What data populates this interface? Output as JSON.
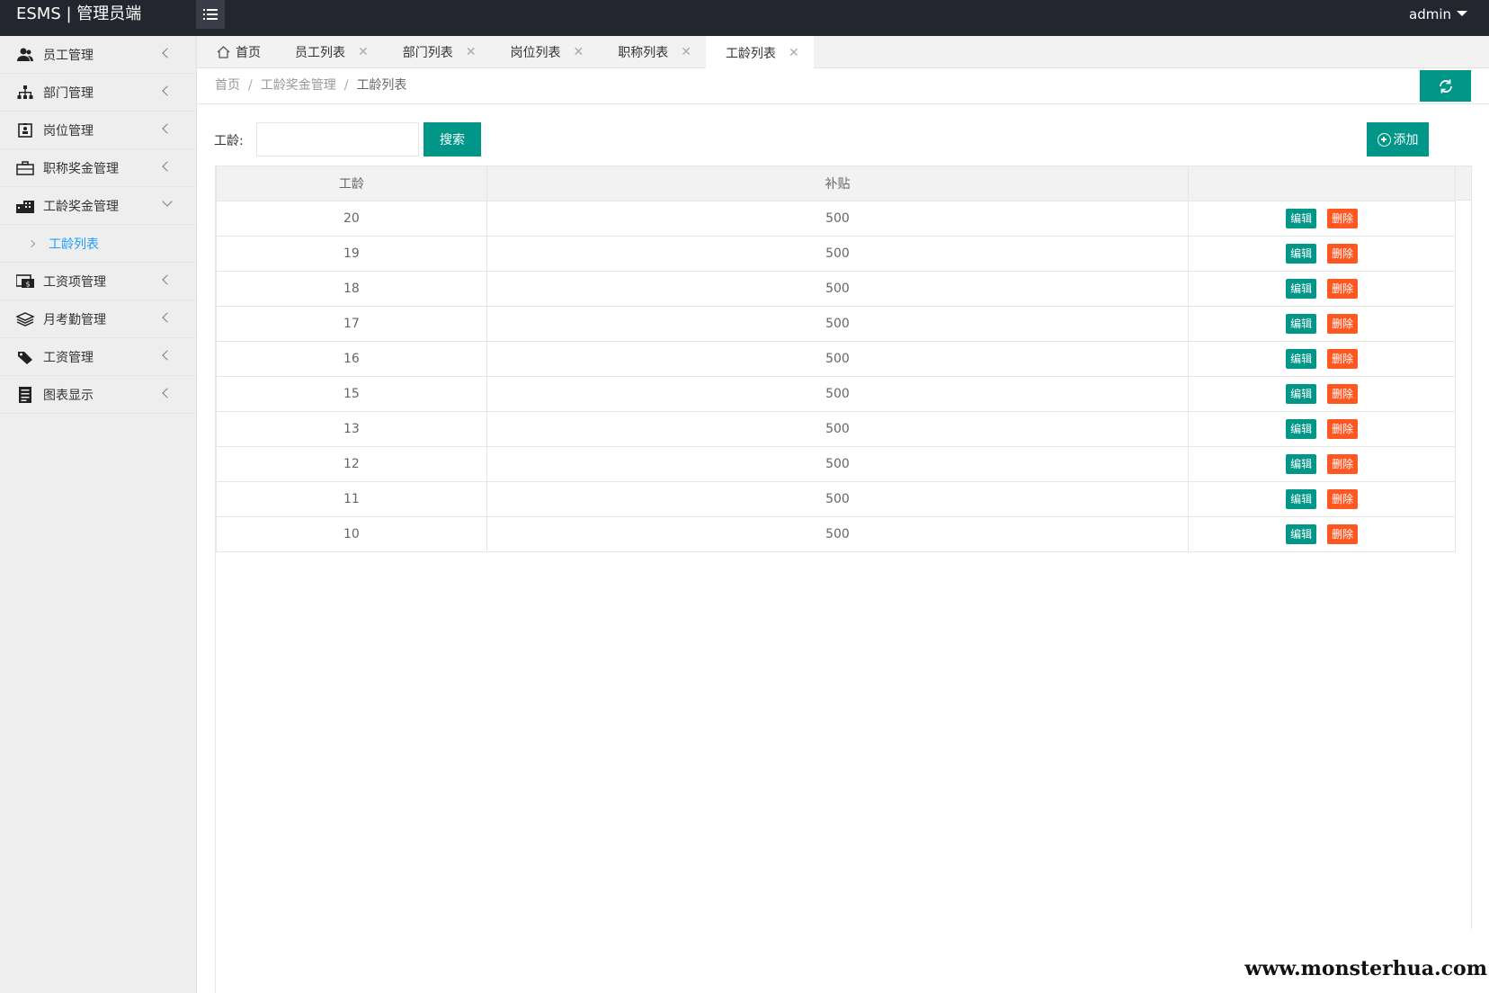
{
  "header": {
    "brand": "ESMS | 管理员端",
    "user": "admin"
  },
  "sidebar": {
    "items": [
      {
        "label": "员工管理",
        "icon": "users-icon"
      },
      {
        "label": "部门管理",
        "icon": "sitemap-icon"
      },
      {
        "label": "岗位管理",
        "icon": "badge-icon"
      },
      {
        "label": "职称奖金管理",
        "icon": "briefcase-icon"
      },
      {
        "label": "工龄奖金管理",
        "icon": "building-icon"
      },
      {
        "label": "工资项管理",
        "icon": "money-icon"
      },
      {
        "label": "月考勤管理",
        "icon": "layers-icon"
      },
      {
        "label": "工资管理",
        "icon": "tag-icon"
      },
      {
        "label": "图表显示",
        "icon": "report-icon"
      }
    ],
    "sub_item": "工龄列表"
  },
  "tabs": [
    {
      "label": "首页"
    },
    {
      "label": "员工列表"
    },
    {
      "label": "部门列表"
    },
    {
      "label": "岗位列表"
    },
    {
      "label": "职称列表"
    },
    {
      "label": "工龄列表"
    }
  ],
  "breadcrumb": {
    "home": "首页",
    "section": "工龄奖金管理",
    "current": "工龄列表"
  },
  "search": {
    "label": "工龄:",
    "value": "",
    "button": "搜索"
  },
  "add_button": "添加",
  "table": {
    "headers": [
      "工龄",
      "补贴",
      ""
    ],
    "rows": [
      {
        "age": "20",
        "subsidy": "500"
      },
      {
        "age": "19",
        "subsidy": "500"
      },
      {
        "age": "18",
        "subsidy": "500"
      },
      {
        "age": "17",
        "subsidy": "500"
      },
      {
        "age": "16",
        "subsidy": "500"
      },
      {
        "age": "15",
        "subsidy": "500"
      },
      {
        "age": "13",
        "subsidy": "500"
      },
      {
        "age": "12",
        "subsidy": "500"
      },
      {
        "age": "11",
        "subsidy": "500"
      },
      {
        "age": "10",
        "subsidy": "500"
      }
    ],
    "edit_label": "编辑",
    "delete_label": "删除"
  },
  "watermark": "www.monsterhua.com",
  "colors": {
    "primary": "#009688",
    "danger": "#ff5722",
    "topbar": "#23262e",
    "link": "#1e9fff"
  }
}
